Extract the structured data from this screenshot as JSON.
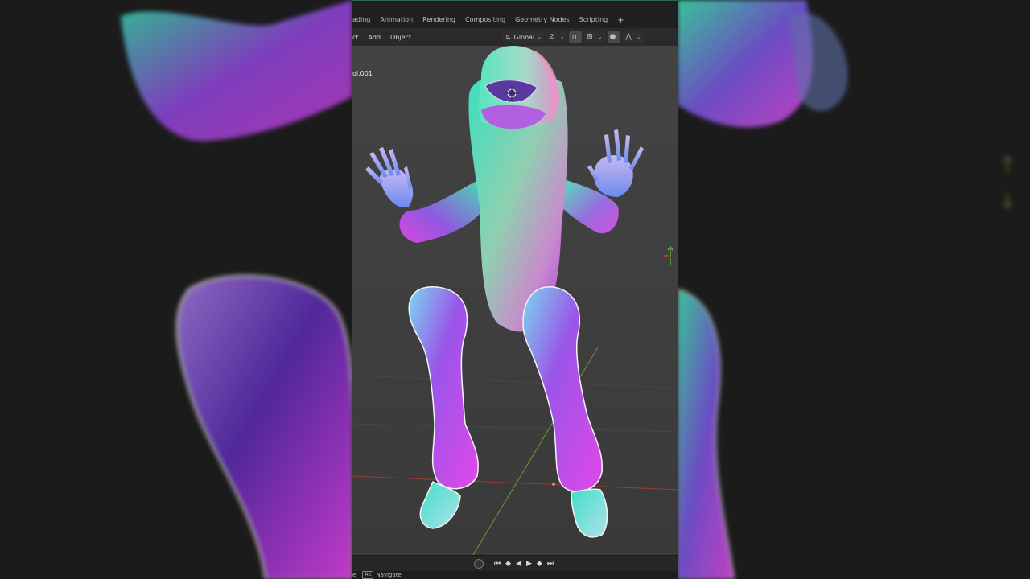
{
  "workspaces": {
    "tabs": [
      "ading",
      "Animation",
      "Rendering",
      "Compositing",
      "Geometry Nodes",
      "Scripting"
    ],
    "add_label": "+"
  },
  "header": {
    "menus": [
      "ct",
      "Add",
      "Object"
    ],
    "orientation": "Global"
  },
  "viewport": {
    "object_label": "ol.001"
  },
  "statusbar": {
    "prefix": "e",
    "key": "Alt",
    "action": "Navigate"
  },
  "colors": {
    "accent": "#2e6b4e",
    "viewport_bg": "#3d3d3d",
    "axis_x": "#b04040",
    "axis_y": "#6a9a3a"
  }
}
